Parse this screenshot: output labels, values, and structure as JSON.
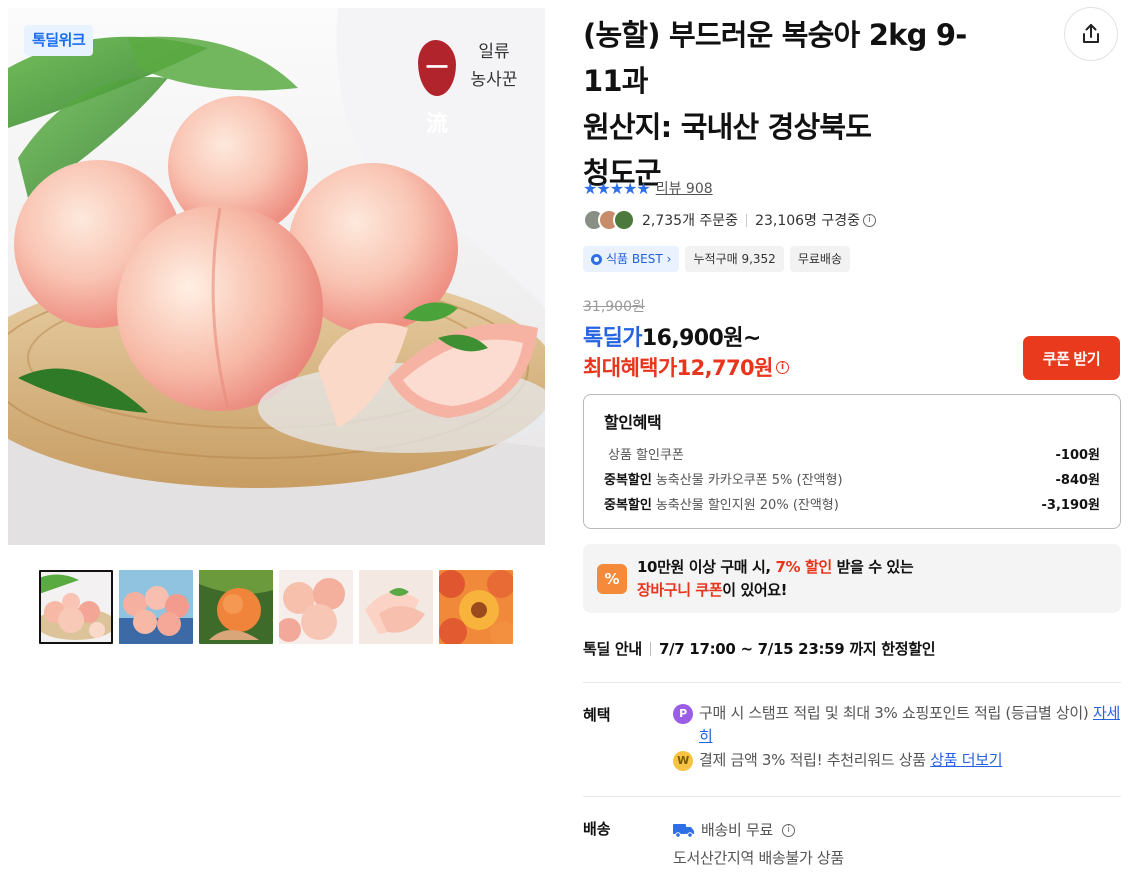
{
  "gallery": {
    "badge": "톡딜위크",
    "brand_seal": "一流",
    "brand_name": "일류\n농사꾼",
    "thumbnails": [
      "thumb-1",
      "thumb-2",
      "thumb-3",
      "thumb-4",
      "thumb-5",
      "thumb-6"
    ],
    "active_thumbnail": 0
  },
  "product": {
    "title": "(농할) 부드러운 복숭아 2kg 9-\n11과\n원산지: 국내산 경상북도\n청도군",
    "rating_stars": "★★★★★",
    "review_link": "리뷰 908",
    "orders": "2,735개 주문중",
    "viewers": "23,106명 구경중",
    "info_glyph": "i",
    "tags": {
      "best": "식품 BEST",
      "best_chevron": "›",
      "cumulative": "누적구매 9,352",
      "shipping": "무료배송"
    },
    "original_price": "31,900원",
    "deal_label": "톡딜가",
    "deal_price": "16,900원~",
    "max_benefit_label": "최대혜택가",
    "max_benefit_price": "12,770원",
    "coupon_button": "쿠폰 받기"
  },
  "discount": {
    "heading": "할인혜택",
    "rows": [
      {
        "prefix": "",
        "label": "상품 할인쿠폰",
        "amount": "-100원"
      },
      {
        "prefix": "중복할인",
        "label": "농축산물 카카오쿠폰 5% (잔액형)",
        "amount": "-840원"
      },
      {
        "prefix": "중복할인",
        "label": "농축산물 할인지원 20% (잔액형)",
        "amount": "-3,190원"
      }
    ]
  },
  "cart_banner": {
    "icon": "%",
    "line1_a": "10만원 이상 구매 시, ",
    "line1_red": "7% 할인",
    "line1_b": " 받을 수 있는",
    "line2_red": "장바구니 쿠폰",
    "line2_b": "이 있어요!"
  },
  "deal_guide": {
    "label": "톡딜 안내",
    "period": "7/7 17:00 ~ 7/15 23:59 까지 한정할인"
  },
  "benefits": {
    "label": "혜택",
    "item1_coin": "P",
    "item1_text": "구매 시 스탬프 적립 및 최대 3% 쇼핑포인트 적립 (등급별 상이) ",
    "item1_link": "자세히",
    "item2_coin": "W",
    "item2_text": "결제 금액 3% 적립! 추천리워드 상품 ",
    "item2_link": "상품 더보기"
  },
  "shipping": {
    "label": "배송",
    "fee": "배송비 무료",
    "note": "도서산간지역 배송불가 상품"
  },
  "colors": {
    "accent_blue": "#2563e0",
    "accent_red": "#e8351c",
    "coupon_button": "#ea3a1e",
    "star": "#2e6fea"
  }
}
